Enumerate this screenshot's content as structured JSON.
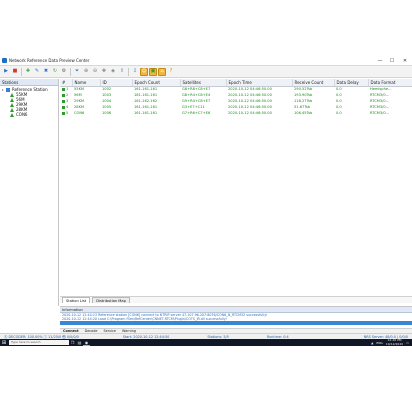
{
  "window": {
    "title": "Network Reference Data Preview Center",
    "minimize_glyph": "—",
    "maximize_glyph": "☐",
    "close_glyph": "✕"
  },
  "toolbar": {
    "buttons": [
      {
        "icon": "connect-icon",
        "glyph": "▶",
        "color": "#2a6fd0"
      },
      {
        "icon": "stop-icon",
        "glyph": "■",
        "color": "#d23a2a"
      },
      {
        "icon": "add-icon",
        "glyph": "✚",
        "color": "#2e9b2e"
      },
      {
        "icon": "edit-icon",
        "glyph": "✎",
        "color": "#2a6fd0"
      },
      {
        "icon": "delete-icon",
        "glyph": "✖",
        "color": "#2a6fd0"
      },
      {
        "icon": "refresh-icon",
        "glyph": "↻",
        "color": "#2e9b2e"
      },
      {
        "icon": "settings-icon",
        "glyph": "⚙",
        "color": "#666666"
      },
      {
        "icon": "filter-icon",
        "glyph": "⏷",
        "color": "#2a6fd0"
      },
      {
        "icon": "zoom-in-icon",
        "glyph": "⊕",
        "color": "#777777"
      },
      {
        "icon": "zoom-out-icon",
        "glyph": "⊖",
        "color": "#777777"
      },
      {
        "icon": "pan-icon",
        "glyph": "✥",
        "color": "#777777"
      },
      {
        "icon": "layers-icon",
        "glyph": "◈",
        "color": "#777777"
      },
      {
        "icon": "upload-icon",
        "glyph": "⇧",
        "color": "#2a6fd0"
      },
      {
        "icon": "download-icon",
        "glyph": "⇩",
        "color": "#2a6fd0"
      },
      {
        "icon": "user-icon",
        "glyph": "☺",
        "color": "#ffffff"
      },
      {
        "icon": "export-icon",
        "glyph": "▣",
        "color": "#2e9b2e"
      },
      {
        "icon": "home-icon",
        "glyph": "⌂",
        "color": "#ffffff"
      },
      {
        "icon": "help-icon",
        "glyph": "?",
        "color": "#e08a00"
      }
    ]
  },
  "sidebar": {
    "header": "Stations",
    "root_label": "Reference Station",
    "stations": [
      "55KM",
      "56M",
      "29KM",
      "28KM",
      "CON6"
    ]
  },
  "grid": {
    "columns": [
      "#",
      "Name",
      "ID",
      "Epoch Count",
      "Satellites",
      "Epoch Time",
      "Receive Count",
      "Data Delay",
      "Data Format"
    ],
    "rows": [
      [
        "1",
        "55KM",
        "1002",
        "161-161-161",
        "G8+R8+C8+E7",
        "2020-10-12 04:46:50.00",
        "290.52Tsb",
        "0.0",
        "Hemisphe..."
      ],
      [
        "2",
        "56M",
        "1003",
        "161-161-161",
        "G8+R4+C8+E4",
        "2020-10-12 04:46:50.00",
        "193.90Tsb",
        "0.0",
        "RTCM3/0..."
      ],
      [
        "3",
        "29KM",
        "1004",
        "161-162-162",
        "G9+R4+C8+E7",
        "2020-10-12 04:46:50.00",
        "118.27Tsb",
        "0.0",
        "RTCM3/0..."
      ],
      [
        "4",
        "28KM",
        "1005",
        "161-161-161",
        "G3+E7+C11",
        "2020-10-12 04:46:50.00",
        "51.67Tsb",
        "0.0",
        "RTCM3/0..."
      ],
      [
        "5",
        "CON6",
        "1006",
        "161-161-161",
        "G7+R6+C7+E6",
        "2020-10-12 04:46:50.00",
        "106.45Tsb",
        "0.0",
        "RTCM3/0..."
      ]
    ]
  },
  "view_tabs": [
    "Station List",
    "Distribution Map"
  ],
  "info": {
    "header": "Information",
    "lines": [
      "2020-10-12 12:44:13 Reference station [CON6] connect to NTRIP server 47.107.96.207:8076/CON6_N_RTCM32 successfully!",
      "2020-10-12 12:44:20 Load C:\\Program Files\\RefCenter\\CNNET-RTCM\\Plugin\\COTS_IR.dll successfully!",
      ""
    ]
  },
  "bottom_tabs": [
    "Connect",
    "Decode",
    "Service",
    "Warning"
  ],
  "status": {
    "left": "Ⓢ DECODER: 100.00% ⓘ 11/25/0 ㉿ 0/0/0/0",
    "start": "Start: 2020-10-12 12:44:50",
    "stations": "Stations: 5/5",
    "runtime": "Runtime: 0:4",
    "server": "NRS Server: 48/0.0 | 0/0/0"
  },
  "taskbar": {
    "search_placeholder": "Type here to search",
    "clock_time": "12:46 PM",
    "clock_date": "10/12/2020",
    "language": "ENG"
  }
}
